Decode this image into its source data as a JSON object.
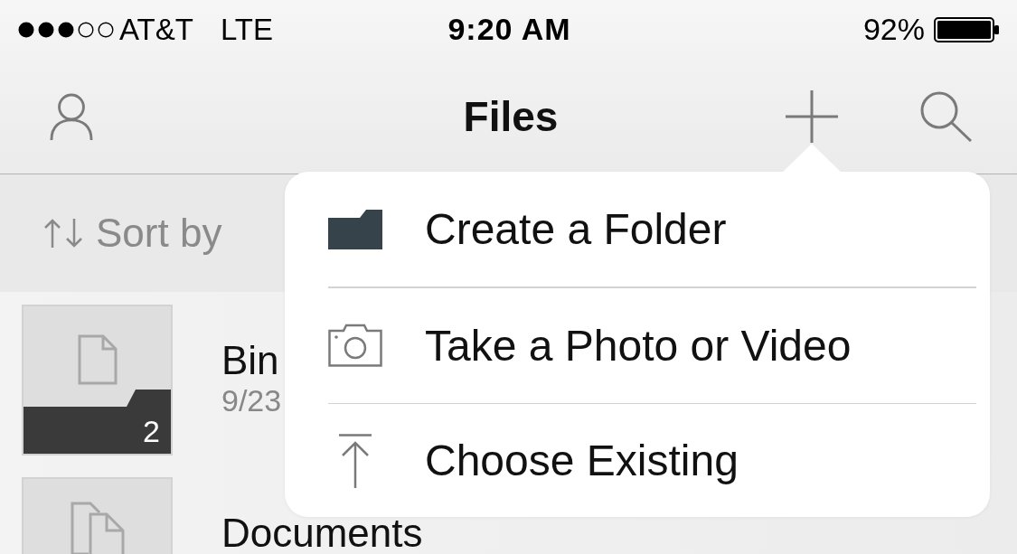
{
  "status_bar": {
    "carrier": "AT&T",
    "network": "LTE",
    "time": "9:20 AM",
    "battery": "92%"
  },
  "nav_bar": {
    "title": "Files"
  },
  "sort_bar": {
    "label": "Sort by"
  },
  "files": [
    {
      "kind": "page",
      "name": "Bin",
      "date": "9/23",
      "count": "2"
    },
    {
      "kind": "pages",
      "name": "Documents"
    }
  ],
  "popover_menu": {
    "items": [
      {
        "kind": "folder",
        "label": "Create a Folder"
      },
      {
        "kind": "camera",
        "label": "Take a Photo or Video"
      },
      {
        "kind": "upload",
        "label": "Choose Existing"
      }
    ]
  }
}
